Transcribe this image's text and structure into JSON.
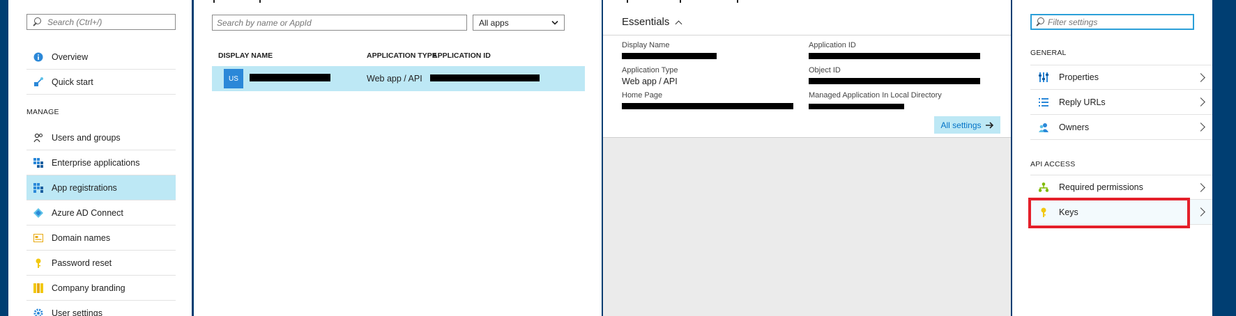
{
  "colors": {
    "accent": "#0072c6",
    "selected_bg": "#bde8f5",
    "frame": "#003e72",
    "highlight": "#e4202a"
  },
  "nav": {
    "search_placeholder": "Search (Ctrl+/)",
    "items": [
      {
        "label": "Overview",
        "icon": "info-icon"
      },
      {
        "label": "Quick start",
        "icon": "quickstart-icon"
      }
    ],
    "section_manage": "MANAGE",
    "manage_items": [
      {
        "label": "Users and groups",
        "icon": "users-icon"
      },
      {
        "label": "Enterprise applications",
        "icon": "enterprise-apps-icon"
      },
      {
        "label": "App registrations",
        "icon": "app-registrations-icon"
      },
      {
        "label": "Azure AD Connect",
        "icon": "ad-connect-icon"
      },
      {
        "label": "Domain names",
        "icon": "domain-icon"
      },
      {
        "label": "Password reset",
        "icon": "key-icon"
      },
      {
        "label": "Company branding",
        "icon": "branding-icon"
      },
      {
        "label": "User settings",
        "icon": "gear-icon"
      }
    ]
  },
  "list": {
    "search_placeholder": "Search by name or AppId",
    "filter_value": "All apps",
    "columns": [
      "DISPLAY NAME",
      "APPLICATION TYPE",
      "APPLICATION ID"
    ],
    "rows": [
      {
        "avatar": "US",
        "name": "",
        "type": "Web app / API",
        "id": ""
      }
    ]
  },
  "app": {
    "essentials_title": "Essentials",
    "display_name_label": "Display Name",
    "app_type_label": "Application Type",
    "app_type_value": "Web app / API",
    "home_page_label": "Home Page",
    "app_id_label": "Application ID",
    "object_id_label": "Object ID",
    "managed_app_label": "Managed Application In Local Directory",
    "all_settings": "All settings"
  },
  "settings": {
    "filter_placeholder": "Filter settings",
    "section_general": "GENERAL",
    "general_items": [
      {
        "label": "Properties",
        "icon": "properties-icon"
      },
      {
        "label": "Reply URLs",
        "icon": "reply-urls-icon"
      },
      {
        "label": "Owners",
        "icon": "owners-icon"
      }
    ],
    "section_api": "API ACCESS",
    "api_items": [
      {
        "label": "Required permissions",
        "icon": "permissions-icon"
      },
      {
        "label": "Keys",
        "icon": "key-icon"
      }
    ]
  }
}
